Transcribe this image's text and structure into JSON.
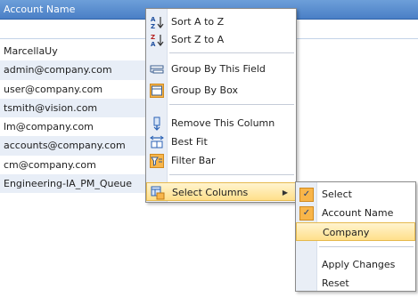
{
  "grid": {
    "column_header": "Account Name",
    "filter_value": "",
    "rows": [
      "MarcellaUy",
      "admin@company.com",
      "user@company.com",
      "tsmith@vision.com",
      "lm@company.com",
      "accounts@company.com",
      "cm@company.com",
      "Engineering-IA_PM_Queue"
    ]
  },
  "context_menu": {
    "sort_asc": "Sort A to Z",
    "sort_desc": "Sort Z to A",
    "group_by_field": "Group By This Field",
    "group_by_box": "Group By Box",
    "remove_column": "Remove This Column",
    "best_fit": "Best Fit",
    "filter_bar": "Filter Bar",
    "select_columns": "Select Columns"
  },
  "submenu": {
    "items": [
      {
        "label": "Select",
        "checked": true
      },
      {
        "label": "Account Name",
        "checked": true
      },
      {
        "label": "Company",
        "checked": false
      }
    ],
    "apply_changes": "Apply Changes",
    "reset": "Reset"
  },
  "colors": {
    "header_bg": "#4a7fc6",
    "row_alt": "#e8eef7",
    "hover_bg": "#ffdf8a",
    "checked_icon_bg": "#f8b54a"
  }
}
